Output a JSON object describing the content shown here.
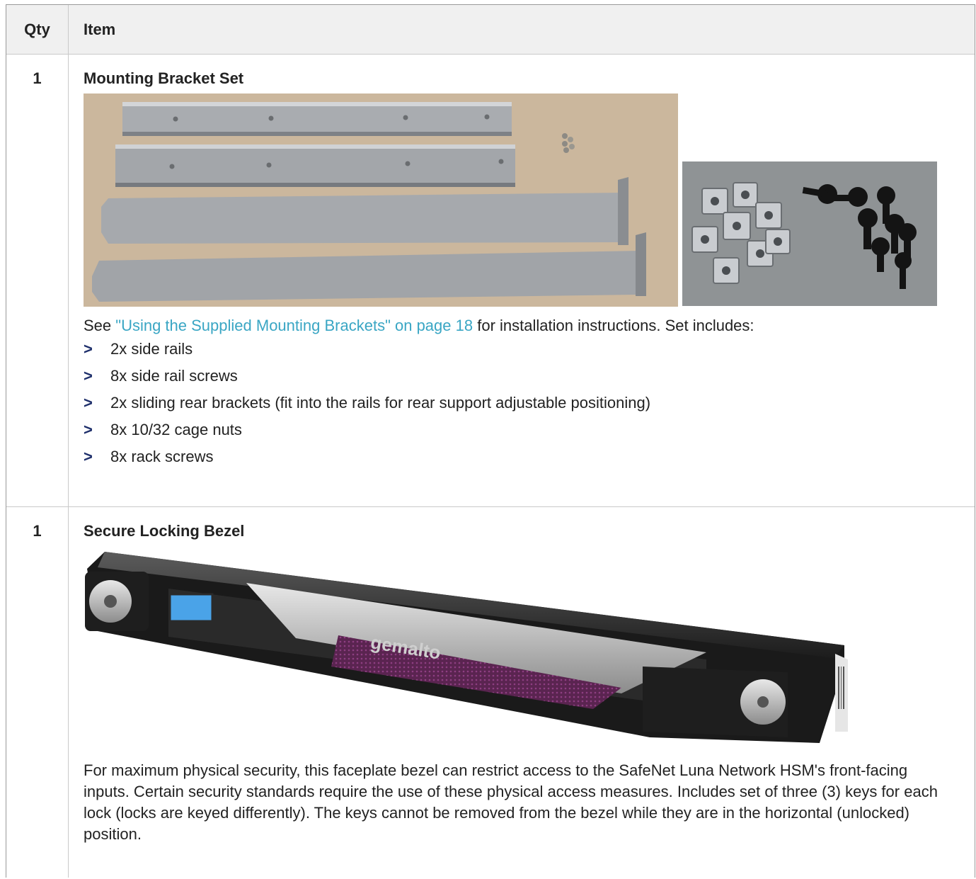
{
  "table": {
    "headers": {
      "qty": "Qty",
      "item": "Item"
    },
    "rows": [
      {
        "qty": "1",
        "title": "Mounting Bracket Set",
        "desc_prefix": "See ",
        "link_text": "\"Using the Supplied Mounting Brackets\" on page 18",
        "desc_suffix": " for installation instructions. Set includes:",
        "bullets": [
          "2x side rails",
          "8x side rail screws",
          "2x sliding rear brackets (fit into the rails for rear support adjustable positioning)",
          "8x 10/32 cage nuts",
          "8x rack screws"
        ]
      },
      {
        "qty": "1",
        "title": "Secure Locking Bezel",
        "bezel_logo": "gemalto",
        "description": "For maximum physical security, this faceplate bezel can restrict access to the SafeNet Luna Network HSM's front-facing inputs. Certain security standards require the use of these physical access measures. Includes set of three (3) keys for each lock (locks are keyed differently). The keys cannot be removed from the bezel while they are in the horizontal (unlocked) position."
      }
    ]
  },
  "colors": {
    "link": "#3aa6c4",
    "bullet": "#1e2f6b",
    "header_bg": "#f0f0f0"
  }
}
